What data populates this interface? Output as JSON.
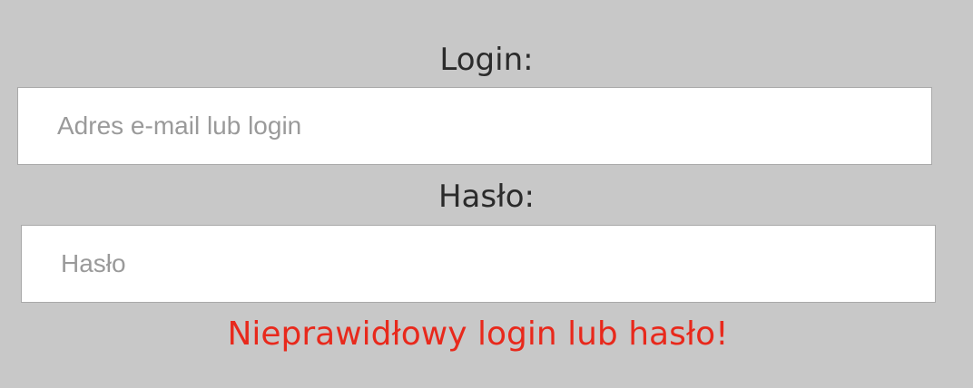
{
  "form": {
    "login_label": "Login:",
    "login_placeholder": "Adres e-mail lub login",
    "login_value": "",
    "password_label": "Hasło:",
    "password_placeholder": "Hasło",
    "password_value": "",
    "error_message": "Nieprawidłowy login lub hasło!"
  },
  "colors": {
    "background": "#c8c8c8",
    "error": "#e8291c",
    "label": "#2b2b2b",
    "placeholder": "#9a9a9a"
  }
}
